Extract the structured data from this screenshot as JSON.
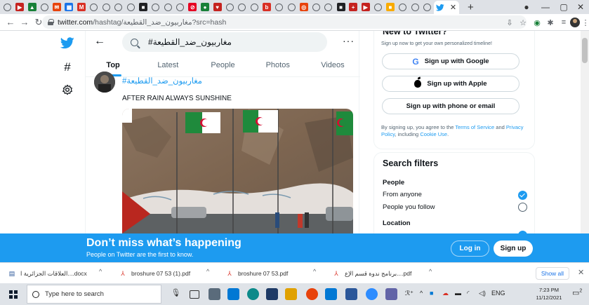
{
  "browser": {
    "tab_favicons": [
      {
        "icon": "chrome-tab-icon",
        "color": "#5f6368",
        "glyph": "⊙"
      },
      {
        "icon": "video-icon",
        "color": "#c5221f",
        "glyph": "▶"
      },
      {
        "icon": "drive-icon",
        "color": "#188038",
        "glyph": "▲"
      },
      {
        "icon": "chrome-tab-icon",
        "color": "#5f6368",
        "glyph": "⊙"
      },
      {
        "icon": "inbox-icon",
        "color": "#e8430c",
        "glyph": "✉"
      },
      {
        "icon": "calendar-icon",
        "color": "#1a73e8",
        "glyph": "▦"
      },
      {
        "icon": "gmail-icon",
        "color": "#d93025",
        "glyph": "M"
      },
      {
        "icon": "chrome-tab-icon",
        "color": "#5f6368",
        "glyph": "⊙"
      },
      {
        "icon": "chrome-tab-icon",
        "color": "#5f6368",
        "glyph": "⊙"
      },
      {
        "icon": "chrome-tab-icon",
        "color": "#5f6368",
        "glyph": "⊙"
      },
      {
        "icon": "chrome-tab-icon",
        "color": "#5f6368",
        "glyph": "⊙"
      },
      {
        "icon": "app-icon",
        "color": "#202124",
        "glyph": "■"
      },
      {
        "icon": "chrome-tab-icon",
        "color": "#5f6368",
        "glyph": "⊙"
      },
      {
        "icon": "chrome-tab-icon",
        "color": "#5f6368",
        "glyph": "⊙"
      },
      {
        "icon": "chrome-tab-icon",
        "color": "#5f6368",
        "glyph": "⊙"
      },
      {
        "icon": "pinterest-icon",
        "color": "#e60023",
        "glyph": "⊘"
      },
      {
        "icon": "record-icon",
        "color": "#188038",
        "glyph": "●"
      },
      {
        "icon": "heart-icon",
        "color": "#c5221f",
        "glyph": "♥"
      },
      {
        "icon": "chrome-tab-icon",
        "color": "#5f6368",
        "glyph": "⊙"
      },
      {
        "icon": "chrome-tab-icon",
        "color": "#5f6368",
        "glyph": "⊙"
      },
      {
        "icon": "chrome-tab-icon",
        "color": "#5f6368",
        "glyph": "⊙"
      },
      {
        "icon": "bookmark-icon",
        "color": "#d93025",
        "glyph": "b"
      },
      {
        "icon": "chrome-tab-icon",
        "color": "#5f6368",
        "glyph": "⊙"
      },
      {
        "icon": "chrome-tab-icon",
        "color": "#5f6368",
        "glyph": "⊙"
      },
      {
        "icon": "opera-icon",
        "color": "#e8430c",
        "glyph": "◎"
      },
      {
        "icon": "chrome-tab-icon",
        "color": "#5f6368",
        "glyph": "⊙"
      },
      {
        "icon": "chrome-tab-icon",
        "color": "#5f6368",
        "glyph": "⊙"
      },
      {
        "icon": "slides-icon",
        "color": "#202124",
        "glyph": "■"
      },
      {
        "icon": "plus-icon",
        "color": "#c5221f",
        "glyph": "+"
      },
      {
        "icon": "youtube-icon",
        "color": "#c5221f",
        "glyph": "▶"
      },
      {
        "icon": "chrome-tab-icon",
        "color": "#5f6368",
        "glyph": "⊙"
      },
      {
        "icon": "yellow-app-icon",
        "color": "#f9ab00",
        "glyph": "■"
      },
      {
        "icon": "chrome-tab-icon",
        "color": "#5f6368",
        "glyph": "⊙"
      },
      {
        "icon": "chrome-tab-icon",
        "color": "#5f6368",
        "glyph": "⊙"
      },
      {
        "icon": "chrome-tab-icon",
        "color": "#5f6368",
        "glyph": "⊙"
      }
    ],
    "url_host": "twitter.com",
    "url_path": "/hashtag/مغاربيون_ضد_القطيعة?src=hash"
  },
  "twitter": {
    "search_value": "#مغاربيون_ضد_القطيعة",
    "tabs": [
      "Top",
      "Latest",
      "People",
      "Photos",
      "Videos"
    ],
    "tweet_hashtag": "#مغاربيون_ضد_القطيعة",
    "tweet_text": "AFTER RAIN ALWAYS SUNSHINE",
    "new_to_twitter": {
      "title": "New to Twitter?",
      "subtitle": "Sign up now to get your own personalized timeline!",
      "google": "Sign up with Google",
      "apple": "Sign up with Apple",
      "phone": "Sign up with phone or email",
      "terms_prefix": "By signing up, you agree to the ",
      "terms_link": "Terms of Service",
      "terms_mid": " and ",
      "privacy_link": "Privacy Policy",
      "terms_mid2": ", including ",
      "cookie_link": "Cookie Use",
      "terms_end": "."
    },
    "filters": {
      "title": "Search filters",
      "people_heading": "People",
      "from_anyone": "From anyone",
      "people_you_follow": "People you follow",
      "location_heading": "Location"
    },
    "banner": {
      "title": "Don’t miss what’s happening",
      "subtitle": "People on Twitter are the first to know.",
      "login": "Log in",
      "signup": "Sign up"
    },
    "brand_color": "#1d9bf0"
  },
  "downloads": {
    "items": [
      "العلاقات الجزائرية ا....docx",
      "broshure 07 53 (1).pdf",
      "broshure 07 53.pdf",
      "برنامج ندوة قسم الإع....pdf"
    ],
    "show_all": "Show all"
  },
  "taskbar": {
    "search_placeholder": "Type here to search",
    "lang": "ENG",
    "time": "7:23 PM",
    "date": "11/12/2021",
    "notifications": "2"
  }
}
